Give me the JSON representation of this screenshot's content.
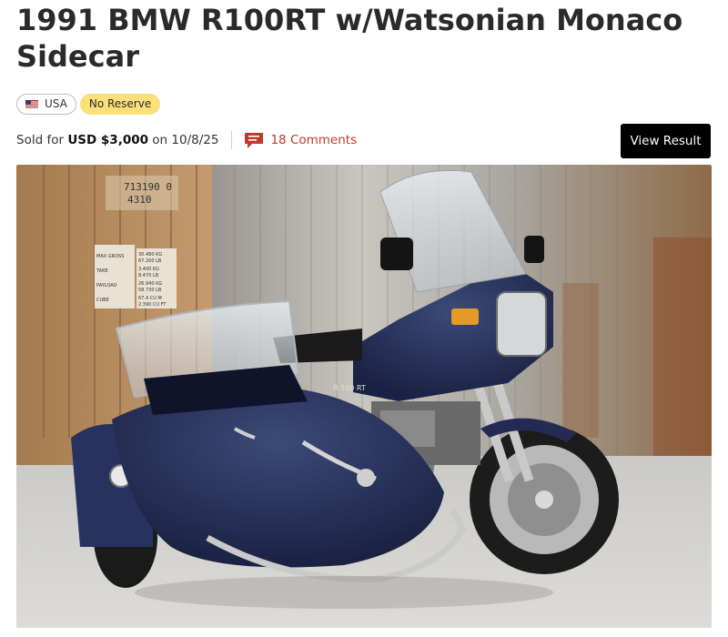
{
  "listing": {
    "title": "1991 BMW R100RT w/Watsonian Monaco Sidecar",
    "country_badge": {
      "label": "USA",
      "icon": "us-flag-icon"
    },
    "reserve_badge": {
      "label": "No Reserve",
      "color": "#fbe07a"
    },
    "sale": {
      "prefix": "Sold for",
      "price": "USD $3,000",
      "on_word": "on",
      "date": "10/8/25"
    },
    "comments": {
      "label": "18 Comments",
      "icon": "comment-bubble-icon",
      "color": "#c0392b"
    },
    "view_result_label": "View Result"
  },
  "photo": {
    "container_text": {
      "number": "713190 0",
      "code": "4310",
      "labels": [
        "MAX GROSS",
        "TARE",
        "PAYLOAD",
        "CUBE"
      ],
      "values": [
        "30.480 KG",
        "67.200 LB",
        "3.400 KG",
        "8.470 LB",
        "26.940 KG",
        "58.730 LB",
        "67.4 CU M",
        "2.390 CU FT"
      ]
    },
    "bike_decal": "R 100 RT"
  }
}
